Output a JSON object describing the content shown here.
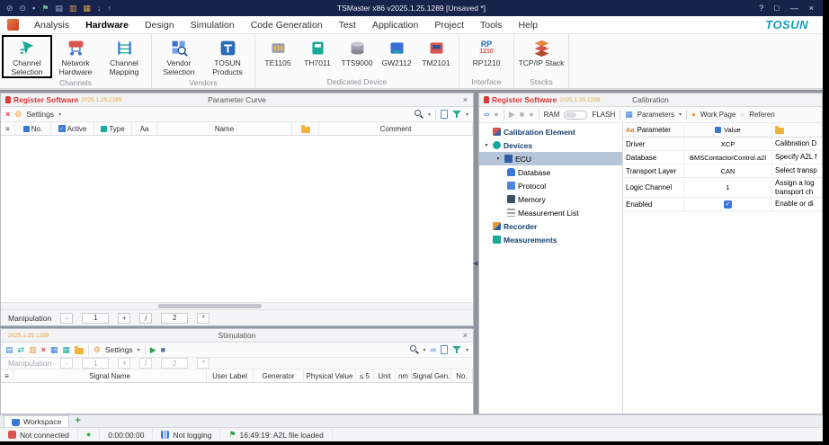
{
  "titlebar": {
    "title": "TSMaster x86 v2025.1.25.1289 [Unsaved *]"
  },
  "menubar": {
    "items": [
      "Analysis",
      "Hardware",
      "Design",
      "Simulation",
      "Code Generation",
      "Test",
      "Application",
      "Project",
      "Tools",
      "Help"
    ],
    "brand": "TOSUN"
  },
  "ribbon": {
    "groups": [
      {
        "label": "Channels",
        "items": [
          {
            "label": "Channel Selection"
          },
          {
            "label": "Network Hardware"
          },
          {
            "label": "Channel Mapping"
          }
        ]
      },
      {
        "label": "Vendors",
        "items": [
          {
            "label": "Vendor Selection"
          },
          {
            "label": "TOSUN Products"
          }
        ]
      },
      {
        "label": "Dedicated Device",
        "items": [
          {
            "label": "TE1105"
          },
          {
            "label": "TH7011"
          },
          {
            "label": "TTS9000"
          },
          {
            "label": "GW2112"
          },
          {
            "label": "TM2101"
          }
        ]
      },
      {
        "label": "Interface",
        "items": [
          {
            "label": "RP1210"
          }
        ]
      },
      {
        "label": "Stacks",
        "items": [
          {
            "label": "TCP/IP Stack"
          }
        ]
      }
    ]
  },
  "parameter_curve": {
    "register_label": "Register Software",
    "version": "2025.1.25.1289",
    "title": "Parameter Curve",
    "settings_label": "Settings",
    "columns": {
      "no": "No.",
      "active": "Active",
      "type": "Type",
      "aa": "Aa",
      "name": "Name",
      "comment": "Comment"
    },
    "manipulation": {
      "label": "Manipulation",
      "minus": "-",
      "value1": "1",
      "plus": "+",
      "divide": "/",
      "value2": "2",
      "multiply": "*"
    }
  },
  "stimulation": {
    "version": "2025.1.25.1289",
    "title": "Stimulation",
    "settings_label": "Settings",
    "manipulation": {
      "label": "Manipulation",
      "minus": "-",
      "value1": "1",
      "plus": "+",
      "divide": "/",
      "value2": "2",
      "multiply": "*"
    },
    "columns": [
      "Signal Name",
      "User Label",
      "Generator",
      "Physical Value",
      "≤ 5",
      "Unit",
      "nm",
      "Signal Gen.",
      "No."
    ]
  },
  "calibration": {
    "register_label": "Register Software",
    "version": "2025.1.25.1289",
    "title": "Calibration",
    "toolbar": {
      "ram": "RAM",
      "flash": "FLASH",
      "parameters": "Parameters",
      "work_page": "Work Page",
      "reference": "Referen"
    },
    "tree": [
      {
        "label": "Calibration Element"
      },
      {
        "label": "Devices"
      },
      {
        "label": "ECU"
      },
      {
        "label": "Database"
      },
      {
        "label": "Protocol"
      },
      {
        "label": "Memory"
      },
      {
        "label": "Measurement List"
      },
      {
        "label": "Recorder"
      },
      {
        "label": "Measurements"
      }
    ],
    "table": {
      "headers": {
        "param": "Parameter",
        "value": "Value"
      },
      "rows": [
        {
          "param": "Driver",
          "value": "XCP",
          "desc": "Calibration D"
        },
        {
          "param": "Database",
          "value": "BMSContactorControl.a2l",
          "desc": "Specify A2L f"
        },
        {
          "param": "Transport Layer",
          "value": "CAN",
          "desc": "Select transp"
        },
        {
          "param": "Logic Channel",
          "value": "1",
          "desc": "Assign a log transport ch"
        },
        {
          "param": "Enabled",
          "value": "✓",
          "desc": "Enable or di"
        }
      ]
    }
  },
  "workspace_bar": {
    "tab": "Workspace",
    "add": "+"
  },
  "statusbar": {
    "connection": "Not connected",
    "timer": "0:00:00:00",
    "logging": "Not logging",
    "message": "16:49:19: A2L file loaded"
  },
  "icons": {
    "tb": [
      "⊘",
      "⊙",
      "▪",
      "⚑",
      "▤",
      "▥",
      "▦",
      "↓",
      "↑"
    ],
    "help": "?",
    "maximize": "□",
    "minimize": "—",
    "close": "×",
    "close_small": "×",
    "gear": "⚙",
    "caret": "▾",
    "expander": "▾",
    "play": "▶",
    "stop": "■",
    "record": "●",
    "list": "▤",
    "swap": "⇄",
    "copy": "▥",
    "calendar": "▦",
    "grid": "▦",
    "link": "∞",
    "dot": "●",
    "circle": "○",
    "check": "✓",
    "flag": "⚑",
    "rows": "≡",
    "left_collapse": "◀",
    "aa": "Aa",
    "rp_top": "RP",
    "rp_bottom": "1210"
  }
}
